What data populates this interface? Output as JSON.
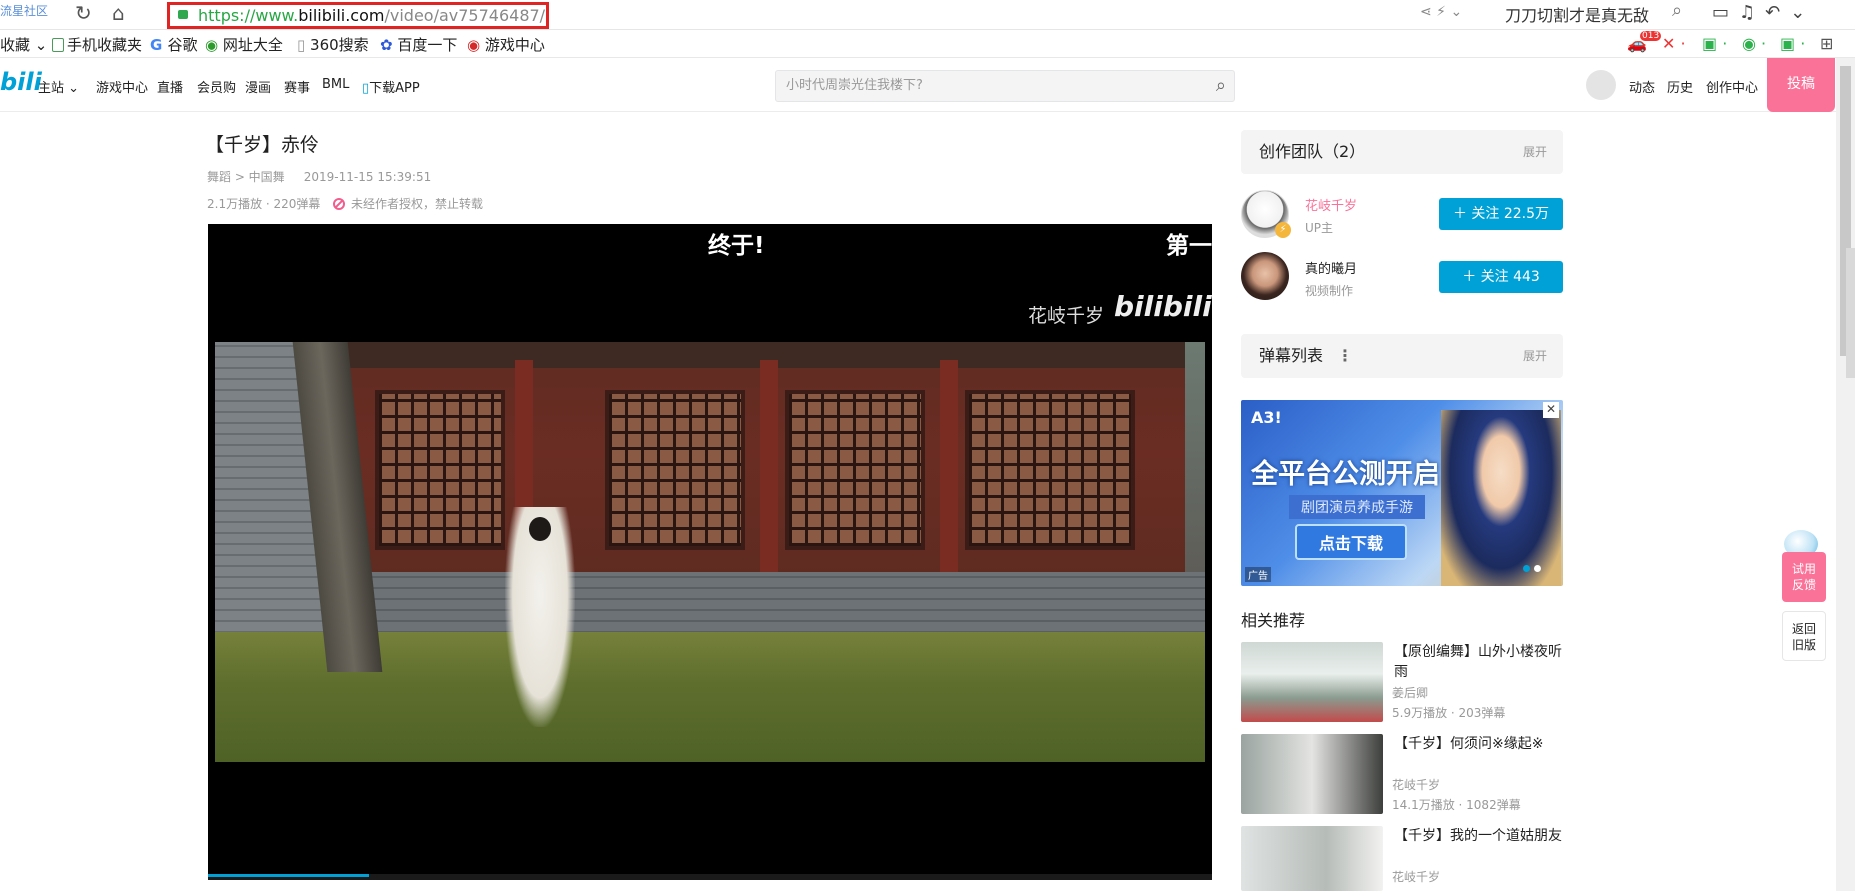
{
  "browser": {
    "brand": "流星社区",
    "url_scheme": "https://www.",
    "url_host": "bilibili.com",
    "url_path": "/video/av75746487/",
    "search_text": "刀刀切割才是真无敌",
    "favorites_label": "收藏",
    "bookmarks": [
      {
        "label": "手机收藏夹"
      },
      {
        "label": "谷歌"
      },
      {
        "label": "网址大全"
      },
      {
        "label": "360搜索"
      },
      {
        "label": "百度一下"
      },
      {
        "label": "游戏中心"
      }
    ],
    "ext_badge": "013"
  },
  "site": {
    "logo": "bili",
    "nav": [
      "主站",
      "游戏中心",
      "直播",
      "会员购",
      "漫画",
      "赛事",
      "BML",
      "下载APP"
    ],
    "search_placeholder": "小时代周崇光住我楼下?",
    "right_links": [
      "动态",
      "历史",
      "创作中心"
    ],
    "upload_label": "投稿"
  },
  "video": {
    "title": "【千岁】赤伶",
    "category": "舞蹈 > 中国舞",
    "date": "2019-11-15 15:39:51",
    "stats": "2.1万播放 · 220弹幕",
    "no_repost": "未经作者授权，禁止转载",
    "caption_a": "终于!",
    "caption_b": "第一",
    "watermark_name": "花岐千岁",
    "watermark_logo": "bilibili",
    "progress": 0.16
  },
  "team": {
    "header": "创作团队（2）",
    "expand": "展开",
    "members": [
      {
        "name": "花岐千岁",
        "role": "UP主",
        "follow": "关注 22.5万",
        "name_color": "#fb7299"
      },
      {
        "name": "真的曦月",
        "role": "视频制作",
        "follow": "关注 443",
        "name_color": "#222222"
      }
    ]
  },
  "danmaku": {
    "header": "弹幕列表",
    "expand": "展开"
  },
  "ad": {
    "brand": "A3!",
    "headline": "全平台公测开启",
    "sub": "剧团演员养成手游",
    "cta": "点击下载",
    "tag": "广告"
  },
  "related": {
    "header": "相关推荐",
    "items": [
      {
        "title": "【原创编舞】山外小楼夜听雨",
        "author": "姜后卿",
        "stats": "5.9万播放 · 203弹幕"
      },
      {
        "title": "【千岁】何须问※缘起※",
        "author": "花岐千岁",
        "stats": "14.1万播放 · 1082弹幕"
      },
      {
        "title": "【千岁】我的一个道姑朋友",
        "author": "花岐千岁",
        "stats": ""
      }
    ]
  },
  "float": {
    "feedback": "试用\n反馈",
    "old": "返回\n旧版"
  }
}
